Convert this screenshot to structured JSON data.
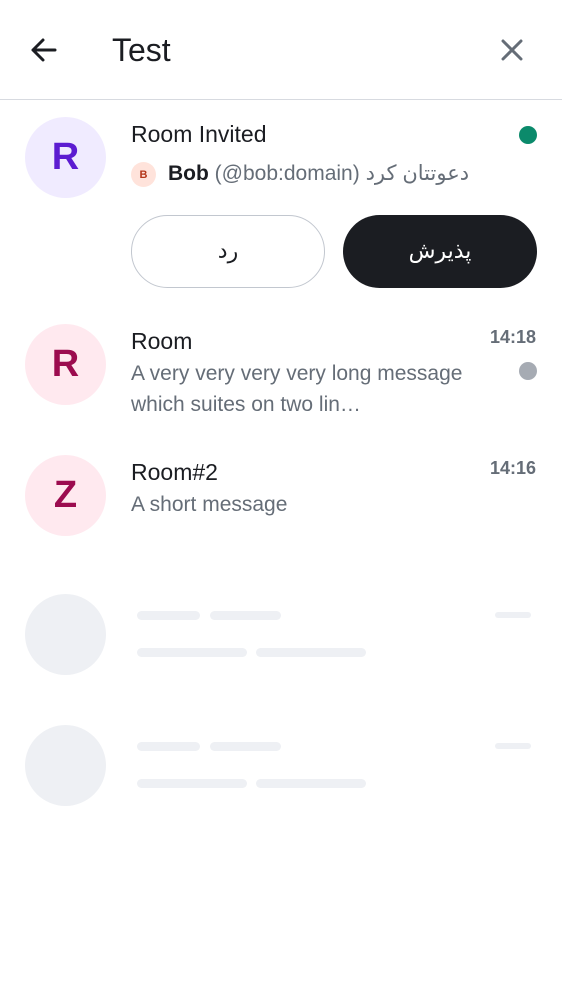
{
  "header": {
    "title": "Test",
    "back_icon": "arrow-left-icon",
    "close_icon": "close-icon"
  },
  "invite": {
    "avatar_letter": "R",
    "avatar_bg": "#f0ebff",
    "avatar_color": "#5c1cd1",
    "room_name": "Room Invited",
    "unread_dot_color": "#0b8a6b",
    "inviter_avatar_letter": "B",
    "inviter_name": "Bob",
    "inviter_id": "(@bob:domain)",
    "invited_text": "دعوتتان کرد",
    "decline_label": "رد",
    "accept_label": "پذیرش"
  },
  "rooms": [
    {
      "avatar_letter": "R",
      "avatar_bg": "#ffe9ef",
      "avatar_color": "#9c0c4f",
      "name": "Room",
      "message": "A very very very very long message which suites on two lin…",
      "time": "14:18",
      "unread_dot_color": "#a6abb3"
    },
    {
      "avatar_letter": "Z",
      "avatar_bg": "#ffe9ef",
      "avatar_color": "#9c0c4f",
      "name": "Room#2",
      "message": "A short message",
      "time": "14:16"
    }
  ]
}
